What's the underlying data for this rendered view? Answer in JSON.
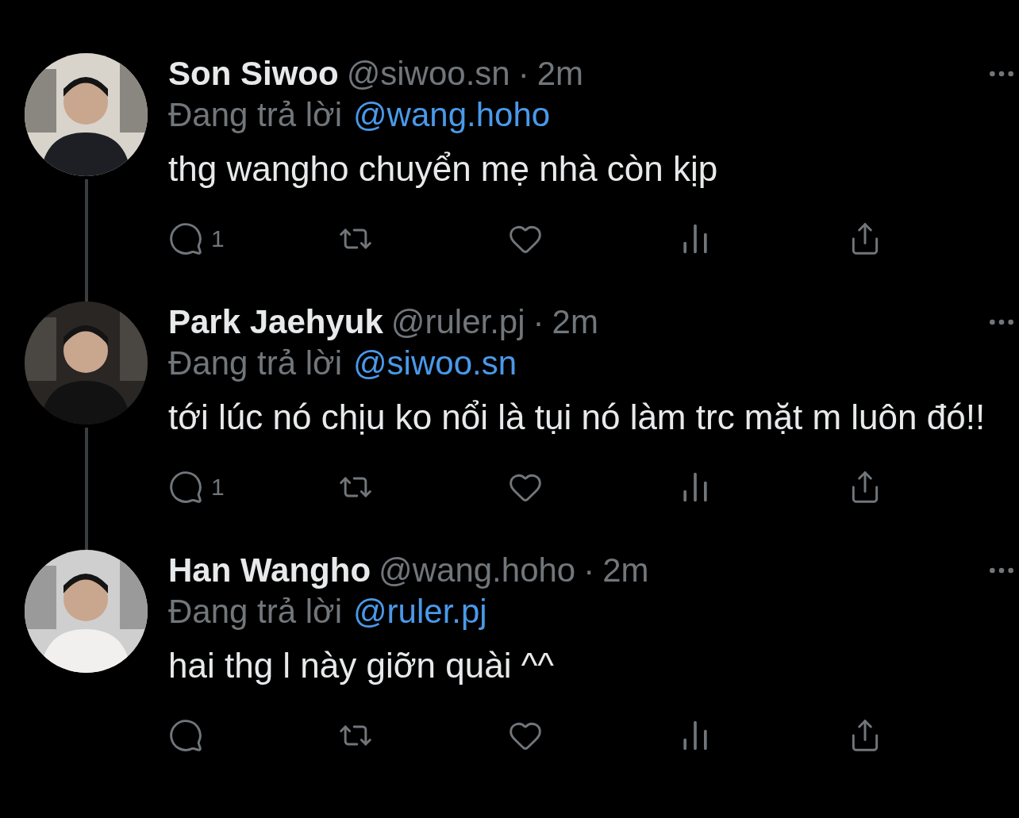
{
  "tweets": [
    {
      "name": "Son Siwoo",
      "handle": "@siwoo.sn",
      "separator": "·",
      "time": "2m",
      "reply_prefix": "Đang trả lời",
      "reply_to": "@wang.hoho",
      "text": "thg wangho chuyển mẹ nhà còn kịp",
      "replies": "1",
      "thread_below": true
    },
    {
      "name": "Park Jaehyuk",
      "handle": "@ruler.pj",
      "separator": "·",
      "time": "2m",
      "reply_prefix": "Đang trả lời",
      "reply_to": "@siwoo.sn",
      "text": "tới lúc nó chịu ko nổi là tụi nó làm trc mặt m luôn đó!!",
      "replies": "1",
      "thread_below": true
    },
    {
      "name": "Han Wangho",
      "handle": "@wang.hoho",
      "separator": "·",
      "time": "2m",
      "reply_prefix": "Đang trả lời",
      "reply_to": "@ruler.pj",
      "text": "hai thg l này giỡn quài ^^",
      "thread_below": false
    }
  ]
}
